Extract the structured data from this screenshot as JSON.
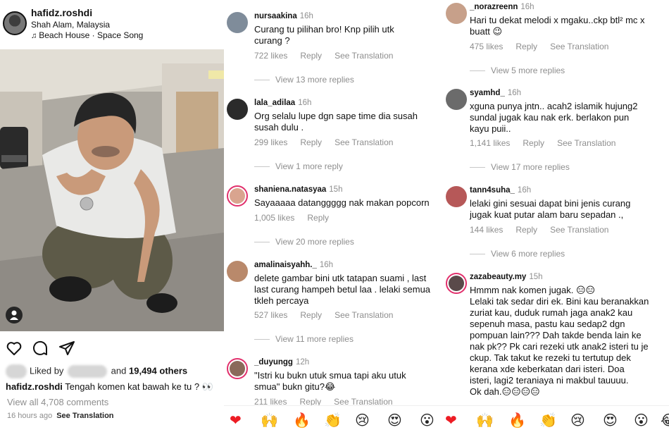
{
  "post": {
    "username": "hafidz.roshdi",
    "location": "Shah Alam, Malaysia",
    "music_note": "♫",
    "music": "Beach House · Space Song",
    "liked_by_prefix": "Liked by",
    "liked_by_and": "and",
    "liked_by_others": "19,494 others",
    "caption_user": "hafidz.roshdi",
    "caption_text": "Tengah komen kat bawah ke tu ? 👀",
    "view_all": "View all 4,708 comments",
    "time_ago": "16 hours ago",
    "see_translation": "See Translation",
    "icons": [
      "heart-icon",
      "comment-icon",
      "share-icon",
      "user-tag-icon"
    ]
  },
  "comments_mid": [
    {
      "user": "nursaakina",
      "time": "16h",
      "text": "Curang tu pilihan bro! Knp pilih utk\ncurang ?",
      "likes": "722 likes",
      "reply": "Reply",
      "translate": "See Translation",
      "more": "View 13 more replies",
      "avatar_color": "#7f8c9a"
    },
    {
      "user": "lala_adilaa",
      "time": "16h",
      "text": "Org selalu lupe dgn sape time dia susah\nsusah dulu .",
      "likes": "299 likes",
      "reply": "Reply",
      "translate": "See Translation",
      "more": "View 1 more reply",
      "avatar_color": "#2b2b2b"
    },
    {
      "user": "shaniena.natasyaa",
      "time": "15h",
      "text": "Sayaaaaa datanggggg nak makan popcorn",
      "likes": "1,005 likes",
      "reply": "Reply",
      "translate": "",
      "more": "View 20 more replies",
      "avatar_color": "#d9a48f"
    },
    {
      "user": "amalinaisyahh._",
      "time": "16h",
      "text": "delete gambar bini utk tatapan suami , last\nlast curang hampeh betul laa . lelaki semua\ntkleh percaya",
      "likes": "527 likes",
      "reply": "Reply",
      "translate": "See Translation",
      "more": "View 11 more replies",
      "avatar_color": "#b9896b"
    },
    {
      "user": "_duyungg",
      "time": "12h",
      "text": "\"Istri ku bukn utuk smua tapi aku utuk\nsmua\"  bukn gitu?😂",
      "likes": "211 likes",
      "reply": "Reply",
      "translate": "See Translation",
      "more": "",
      "avatar_color": "#8a6a5a"
    }
  ],
  "comments_right": [
    {
      "user": "_norazreenn",
      "time": "16h",
      "text": "Hari tu dekat melodi x mgaku..ckp btl² mc x\nbuatt 😉",
      "likes": "475 likes",
      "reply": "Reply",
      "translate": "See Translation",
      "more": "View 5 more replies",
      "avatar_color": "#c7a08a"
    },
    {
      "user": "syamhd_",
      "time": "16h",
      "text": "xguna punya jntn.. acah2 islamik hujung2\nsundal jugak kau nak erk. berlakon pun\nkayu  puii..",
      "likes": "1,141 likes",
      "reply": "Reply",
      "translate": "See Translation",
      "more": "View 17 more replies",
      "avatar_color": "#6b6b6b"
    },
    {
      "user": "tann4suha_",
      "time": "16h",
      "text": "lelaki gini sesuai dapat bini jenis curang\njugak kuat putar alam baru sepadan .,",
      "likes": "144 likes",
      "reply": "Reply",
      "translate": "See Translation",
      "more": "View 6 more replies",
      "avatar_color": "#b65858"
    },
    {
      "user": "zazabeauty.my",
      "time": "15h",
      "text": "Hmmm nak komen jugak. 😑😑\nLelaki tak sedar diri ek. Bini kau beranakkan\nzuriat kau, duduk rumah jaga anak2 kau\nsepenuh masa, pastu kau sedap2 dgn\npompuan lain??? Dah takde benda lain ke\nnak pk?? Pk cari rezeki utk anak2 isteri tu je\nckup. Tak takut ke rezeki tu tertutup dek\nkerana xde keberkatan dari isteri. Doa\nisteri, lagi2 teraniaya ni makbul tauuuu.\nOk dah.😑😑😑😑",
      "likes": "",
      "reply": "",
      "translate": "",
      "more": "",
      "avatar_color": "#5a4a4a"
    }
  ],
  "reactions": [
    "❤",
    "🙌",
    "🔥",
    "👏",
    "😢",
    "😍",
    "😮",
    "❤",
    "🙌",
    "🔥",
    "👏",
    "😢",
    "😍",
    "😮",
    "😂"
  ]
}
